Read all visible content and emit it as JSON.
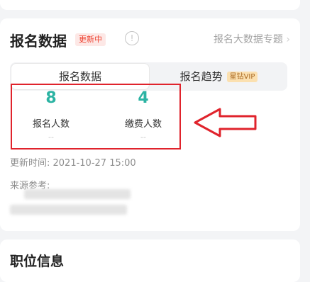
{
  "section": {
    "title": "报名数据",
    "badge": "更新中",
    "info_icon": "info-circle-icon",
    "special_link": "报名大数据专题"
  },
  "tabs": [
    {
      "label": "报名数据",
      "active": true
    },
    {
      "label": "报名趋势",
      "vip_badge": "星钻VIP",
      "active": false
    }
  ],
  "stats": [
    {
      "value": "8",
      "label": "报名人数",
      "sub": "--"
    },
    {
      "value": "4",
      "label": "缴费人数",
      "sub": "--"
    }
  ],
  "update_time": "更新时间: 2021-10-27 15:00",
  "source_label": "来源参考:",
  "next_section": {
    "title": "职位信息"
  },
  "colors": {
    "accent": "#2bb3a3",
    "highlight_box": "#e0232c",
    "badge_text": "#ee4433",
    "vip_text": "#a8661e"
  }
}
